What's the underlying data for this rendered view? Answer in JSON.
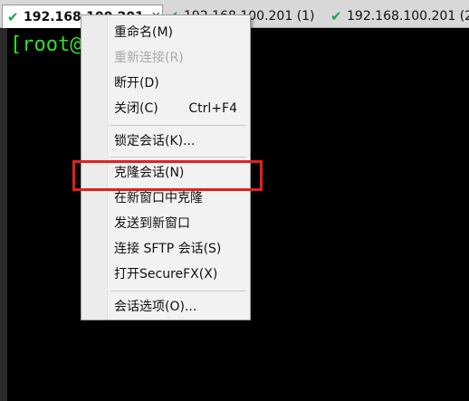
{
  "tabs": [
    {
      "label": "192.168.100.201",
      "active": true,
      "close_glyph": "✕"
    },
    {
      "label": "192.168.100.201 (1)",
      "active": false
    },
    {
      "label": "192.168.100.201 (2",
      "active": false
    }
  ],
  "terminal": {
    "prompt": "[root@",
    "text_color": "#2ee02e",
    "background": "#000000"
  },
  "context_menu": {
    "items": [
      {
        "label": "重命名(M)",
        "enabled": true
      },
      {
        "label": "重新连接(R)",
        "enabled": false
      },
      {
        "label": "断开(D)",
        "enabled": true
      },
      {
        "label": "关闭(C)",
        "shortcut": "Ctrl+F4",
        "enabled": true
      },
      {
        "label": "锁定会话(K)...",
        "enabled": true
      },
      {
        "label": "克隆会话(N)",
        "enabled": true,
        "highlighted": true
      },
      {
        "label": "在新窗口中克隆",
        "enabled": true
      },
      {
        "label": "发送到新窗口",
        "enabled": true
      },
      {
        "label": "连接 SFTP 会话(S)",
        "enabled": true
      },
      {
        "label": "打开SecureFX(X)",
        "enabled": true
      },
      {
        "label": "会话选项(O)...",
        "enabled": true
      }
    ]
  },
  "colors": {
    "highlight_border": "#e02020",
    "tab_check": "#1aa84a",
    "disabled_text": "#a8a8a8"
  },
  "icons": {
    "tab_status": "check-icon",
    "tab_close": "close-icon"
  }
}
